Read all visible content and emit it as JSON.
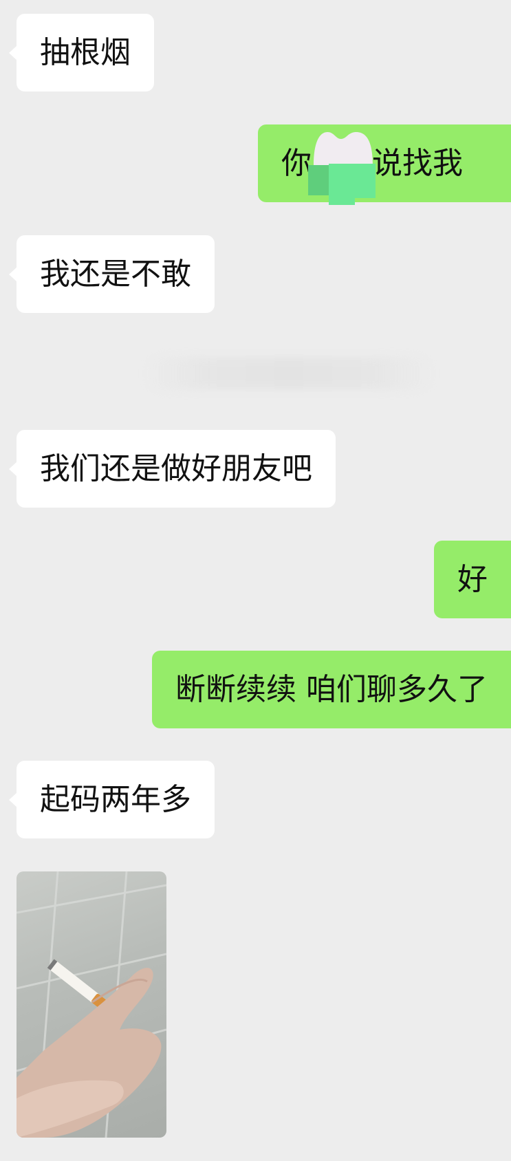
{
  "chat": {
    "messages": [
      {
        "side": "in",
        "text": "抽根烟"
      },
      {
        "side": "out",
        "text": "你",
        "text_after": "说找我"
      },
      {
        "side": "in",
        "text": "我还是不敢"
      },
      {
        "side": "in",
        "text": "我们还是做好朋友吧"
      },
      {
        "side": "out",
        "text": "好"
      },
      {
        "side": "out",
        "text": "断断续续 咱们聊多久了"
      },
      {
        "side": "in",
        "text": "起码两年多"
      }
    ],
    "photo": {
      "description_icon": "cigarette-photo"
    }
  },
  "colors": {
    "background": "#ededed",
    "incoming_bubble": "#ffffff",
    "outgoing_bubble": "#95ec69",
    "text": "#111111"
  }
}
